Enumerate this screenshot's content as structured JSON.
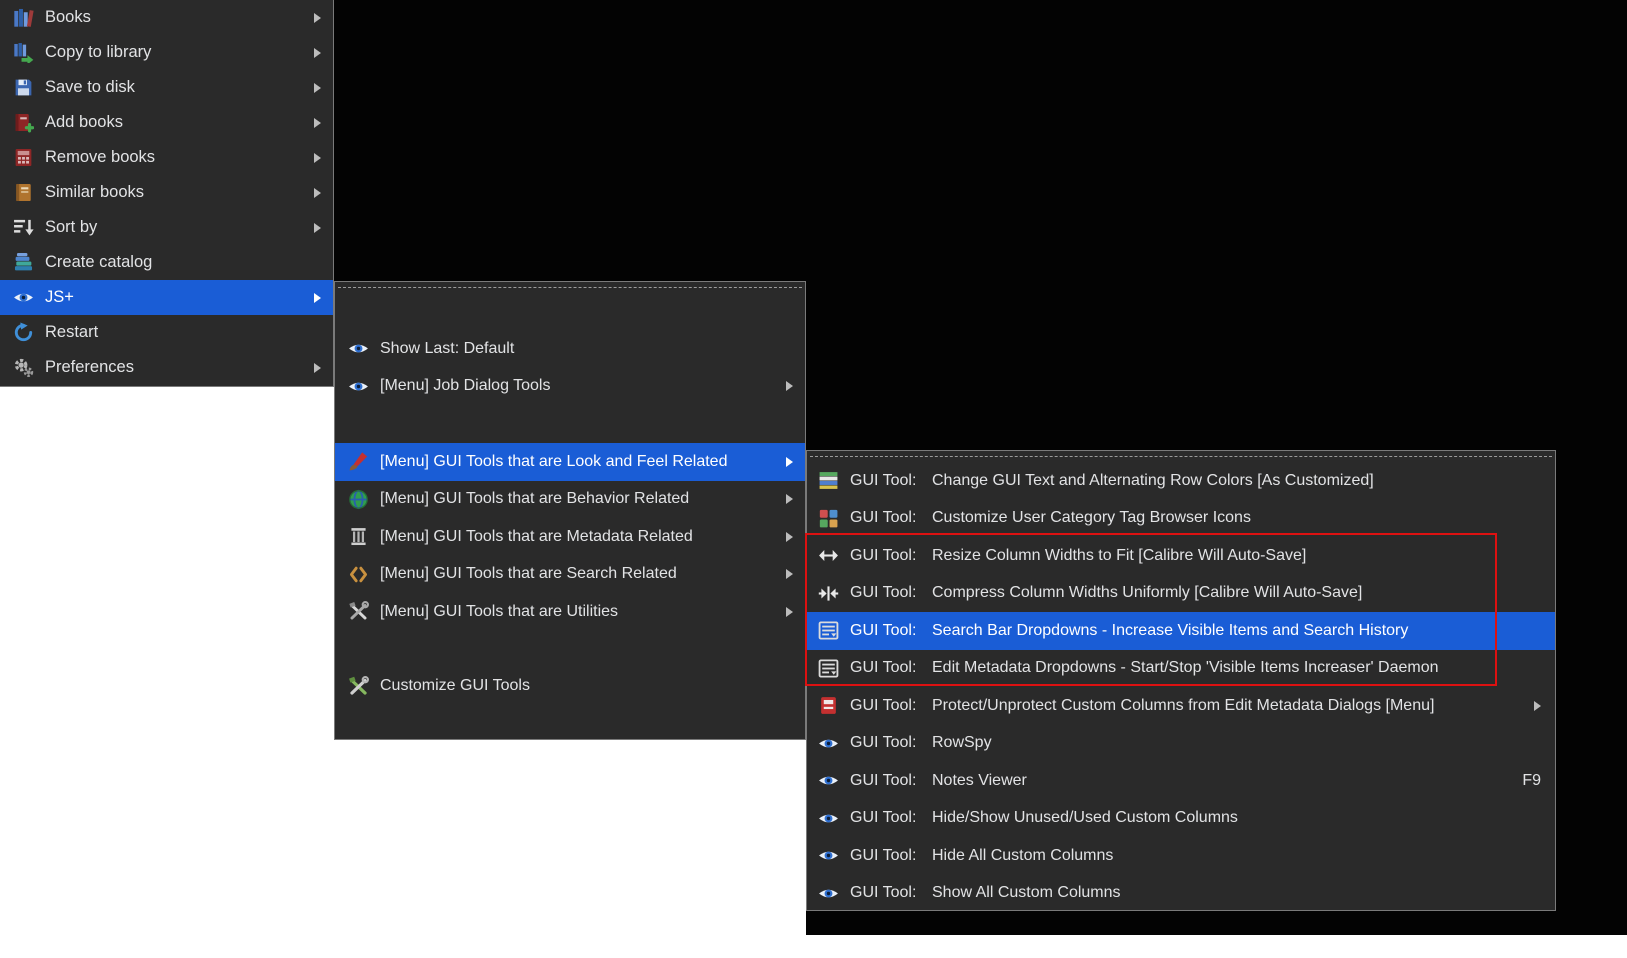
{
  "colors": {
    "app_background": "#030303",
    "desktop_background": "#ffffff",
    "menu_background": "#2a2a2a",
    "menu_border": "#7a7a7a",
    "menu_text": "#e2e3e5",
    "highlight_background": "#1a5dd6",
    "highlight_text": "#ffffff",
    "annotation_box": "#dd1111"
  },
  "menu1": {
    "items": [
      {
        "label": "Books",
        "icon": "books-icon",
        "has_submenu": true
      },
      {
        "label": "Copy to library",
        "icon": "copy-to-library-icon",
        "has_submenu": true
      },
      {
        "label": "Save to disk",
        "icon": "save-to-disk-icon",
        "has_submenu": true
      },
      {
        "label": "Add books",
        "icon": "add-books-icon",
        "has_submenu": true
      },
      {
        "label": "Remove books",
        "icon": "remove-books-icon",
        "has_submenu": true
      },
      {
        "label": "Similar books",
        "icon": "similar-books-icon",
        "has_submenu": true
      },
      {
        "label": "Sort by",
        "icon": "sort-icon",
        "has_submenu": true
      },
      {
        "label": "Create catalog",
        "icon": "create-catalog-icon",
        "has_submenu": false
      },
      {
        "label": "JS+",
        "icon": "eye-icon",
        "has_submenu": true,
        "highlighted": true
      },
      {
        "label": "Restart",
        "icon": "restart-icon",
        "has_submenu": false
      },
      {
        "label": "Preferences",
        "icon": "preferences-gears-icon",
        "has_submenu": true
      }
    ]
  },
  "menu2": {
    "items": [
      {
        "label": "Show Last: Default",
        "icon": "eye-icon",
        "has_submenu": false
      },
      {
        "label": "[Menu] Job Dialog Tools",
        "icon": "eye-icon",
        "has_submenu": true
      },
      {
        "label": "[Menu] GUI Tools that are Look and Feel Related",
        "icon": "paint-brush-icon",
        "has_submenu": true,
        "highlighted": true
      },
      {
        "label": "[Menu] GUI Tools that are Behavior Related",
        "icon": "globe-icon",
        "has_submenu": true
      },
      {
        "label": "[Menu] GUI Tools that are Metadata Related",
        "icon": "pillar-icon",
        "has_submenu": true
      },
      {
        "label": "[Menu] GUI Tools that are Search Related",
        "icon": "quotes-icon",
        "has_submenu": true
      },
      {
        "label": "[Menu] GUI Tools that are Utilities",
        "icon": "crossed-tools-icon",
        "has_submenu": true
      },
      {
        "label": "Customize GUI Tools",
        "icon": "customize-tools-icon",
        "has_submenu": false
      }
    ]
  },
  "menu3": {
    "items": [
      {
        "prefix": "GUI Tool:",
        "text": "Change GUI Text and Alternating Row Colors [As Customized]",
        "icon": "row-colors-icon"
      },
      {
        "prefix": "GUI Tool:",
        "text": "Customize User Category Tag Browser Icons",
        "icon": "tag-icons-icon"
      },
      {
        "prefix": "GUI Tool:",
        "text": "Resize Column Widths to Fit [Calibre Will Auto-Save]",
        "icon": "resize-width-icon"
      },
      {
        "prefix": "GUI Tool:",
        "text": "Compress Column Widths Uniformly [Calibre Will Auto-Save]",
        "icon": "compress-width-icon"
      },
      {
        "prefix": "GUI Tool:",
        "text": "Search Bar Dropdowns - Increase Visible Items and Search History",
        "icon": "dropdown-list-icon",
        "highlighted": true
      },
      {
        "prefix": "GUI Tool:",
        "text": "Edit Metadata Dropdowns - Start/Stop 'Visible Items Increaser' Daemon",
        "icon": "dropdown-list-icon"
      },
      {
        "prefix": "GUI Tool:",
        "text": "Protect/Unprotect Custom Columns from Edit Metadata Dialogs [Menu]",
        "icon": "protect-columns-icon",
        "has_submenu": true
      },
      {
        "prefix": "GUI Tool:",
        "text": "RowSpy",
        "icon": "eye-icon"
      },
      {
        "prefix": "GUI Tool:",
        "text": "Notes Viewer",
        "icon": "eye-icon",
        "shortcut": "F9"
      },
      {
        "prefix": "GUI Tool:",
        "text": "Hide/Show Unused/Used Custom Columns",
        "icon": "eye-icon"
      },
      {
        "prefix": "GUI Tool:",
        "text": "Hide All Custom Columns",
        "icon": "eye-icon"
      },
      {
        "prefix": "GUI Tool:",
        "text": "Show All Custom Columns",
        "icon": "eye-icon"
      }
    ]
  }
}
